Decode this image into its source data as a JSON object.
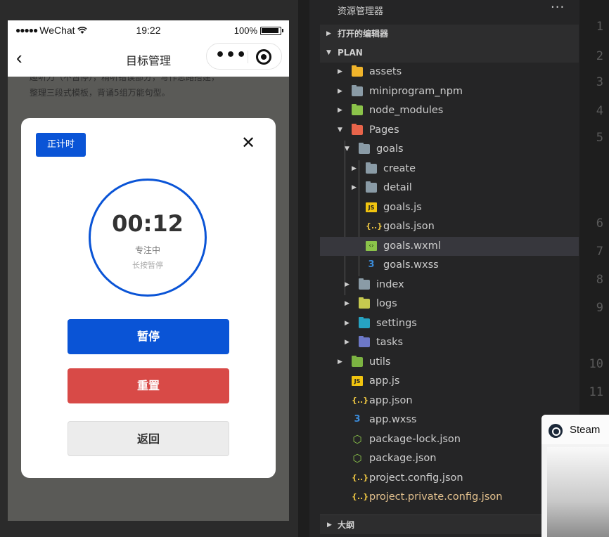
{
  "simulator": {
    "status": {
      "dots": "●●●●●",
      "carrier": "WeChat",
      "time": "19:22",
      "battery": "100%"
    },
    "nav": {
      "back_glyph": "‹",
      "title": "目标管理",
      "more_glyph": "•••"
    },
    "background_text": [
      "趣听力（不暂停），精听错误部分，写作思路搭建，",
      "整理三段式模板，背诵5组万能句型。"
    ],
    "modal": {
      "mode_label": "正计时",
      "close_glyph": "✕",
      "timer": "00:12",
      "state": "专注中",
      "hint": "长按暂停",
      "buttons": {
        "pause": "暂停",
        "reset": "重置",
        "back": "返回"
      }
    },
    "colors": {
      "primary": "#0a54d6",
      "danger": "#d84a47",
      "neutral": "#ececec"
    }
  },
  "explorer": {
    "title": "资源管理器",
    "more": "···",
    "open_editors": "打开的编辑器",
    "project": "PLAN",
    "outline": "大纲",
    "tree": [
      {
        "label": "assets",
        "depth": 0,
        "kind": "folder",
        "twisty": "▸",
        "icon_color": "#f0b42b"
      },
      {
        "label": "miniprogram_npm",
        "depth": 0,
        "kind": "folder",
        "twisty": "▸",
        "icon_color": "#8a9ba6"
      },
      {
        "label": "node_modules",
        "depth": 0,
        "kind": "folder",
        "twisty": "▸",
        "icon_color": "#8bc34a"
      },
      {
        "label": "Pages",
        "depth": 0,
        "kind": "folder-open",
        "twisty": "▾",
        "icon_color": "#e8644a"
      },
      {
        "label": "goals",
        "depth": 1,
        "kind": "folder-open",
        "twisty": "▾",
        "icon_color": "#8a9ba6"
      },
      {
        "label": "create",
        "depth": 2,
        "kind": "folder",
        "twisty": "▸",
        "icon_color": "#8a9ba6"
      },
      {
        "label": "detail",
        "depth": 2,
        "kind": "folder",
        "twisty": "▸",
        "icon_color": "#8a9ba6"
      },
      {
        "label": "goals.js",
        "depth": 2,
        "kind": "js"
      },
      {
        "label": "goals.json",
        "depth": 2,
        "kind": "json"
      },
      {
        "label": "goals.wxml",
        "depth": 2,
        "kind": "wxml",
        "selected": true
      },
      {
        "label": "goals.wxss",
        "depth": 2,
        "kind": "css"
      },
      {
        "label": "index",
        "depth": 1,
        "kind": "folder",
        "twisty": "▸",
        "icon_color": "#8a9ba6"
      },
      {
        "label": "logs",
        "depth": 1,
        "kind": "folder",
        "twisty": "▸",
        "icon_color": "#c6c94f"
      },
      {
        "label": "settings",
        "depth": 1,
        "kind": "folder",
        "twisty": "▸",
        "icon_color": "#26a3c2"
      },
      {
        "label": "tasks",
        "depth": 1,
        "kind": "folder",
        "twisty": "▸",
        "icon_color": "#6d78c7"
      },
      {
        "label": "utils",
        "depth": 0,
        "kind": "folder",
        "twisty": "▸",
        "icon_color": "#7cb342"
      },
      {
        "label": "app.js",
        "depth": 0,
        "kind": "js"
      },
      {
        "label": "app.json",
        "depth": 0,
        "kind": "json"
      },
      {
        "label": "app.wxss",
        "depth": 0,
        "kind": "css"
      },
      {
        "label": "package-lock.json",
        "depth": 0,
        "kind": "node"
      },
      {
        "label": "package.json",
        "depth": 0,
        "kind": "node"
      },
      {
        "label": "project.config.json",
        "depth": 0,
        "kind": "json"
      },
      {
        "label": "project.private.config.json",
        "depth": 0,
        "kind": "json",
        "highlight": true
      }
    ],
    "icon_glyphs": {
      "js": "JS",
      "json": "{..}",
      "css": "3",
      "wxml": "‹›",
      "node": "⬡"
    }
  },
  "editor": {
    "line_numbers": [
      "1",
      "2",
      "3",
      "4",
      "5",
      "6",
      "7",
      "8",
      "9",
      "10",
      "11"
    ]
  },
  "steam": {
    "name": "Steam"
  }
}
